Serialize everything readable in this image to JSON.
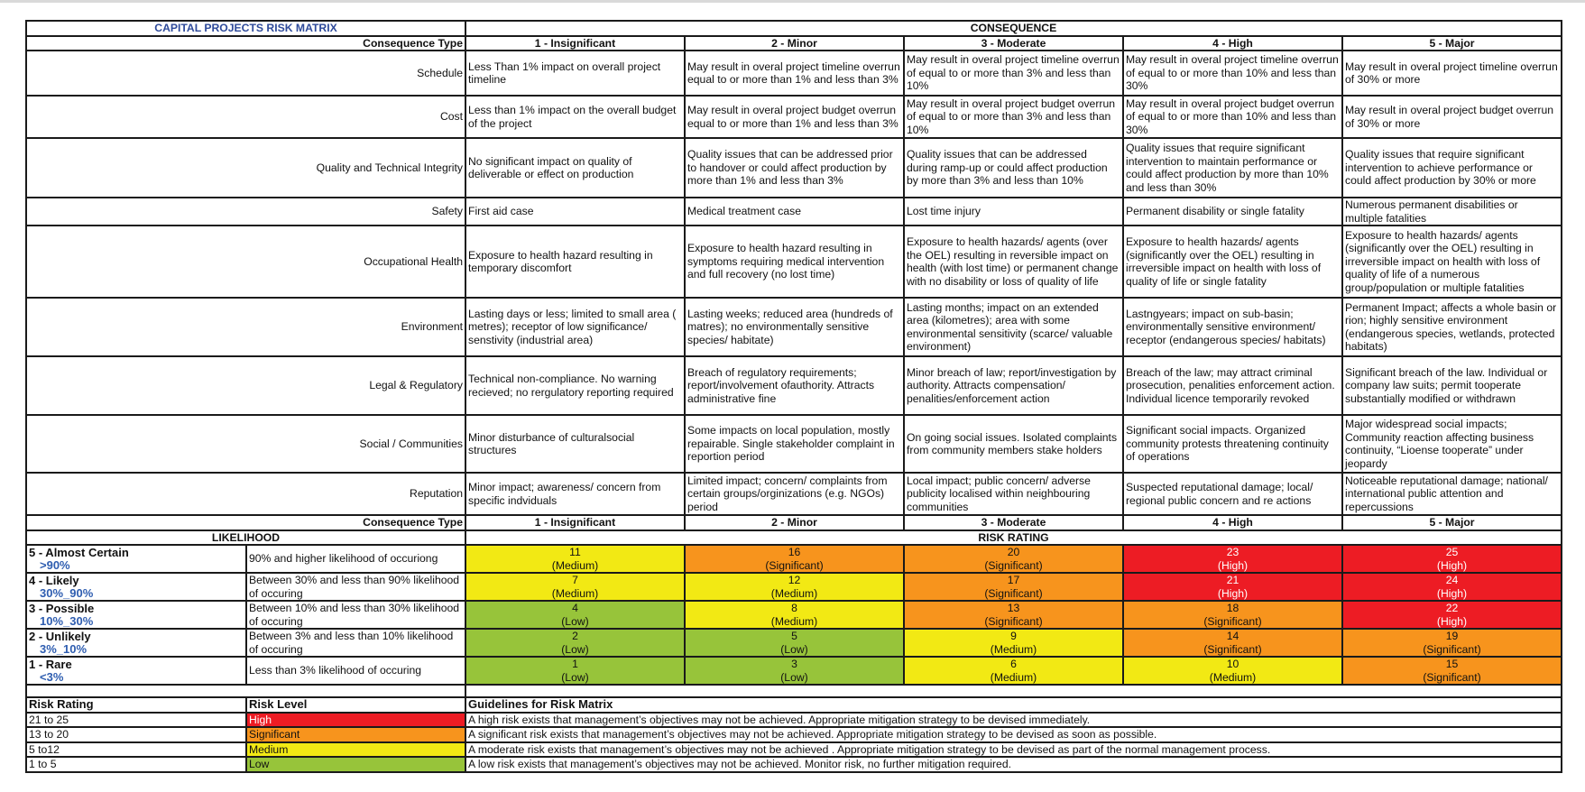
{
  "title": "CAPITAL PROJECTS RISK MATRIX",
  "consequence_header": "CONSEQUENCE",
  "consequence_type_label": "Consequence Type",
  "consequence_levels": [
    "1 - Insignificant",
    "2 - Minor",
    "3 - Moderate",
    "4 - High",
    "5 - Major"
  ],
  "consequence_rows": [
    {
      "type": "Schedule",
      "cells": [
        "Less Than 1% impact on overall project timeline",
        "May result in overal project timeline overrun equal to or more than 1% and less than 3%",
        "May result in overal project timeline overrun of equal to or more than 3% and less than 10%",
        "May result in overal project timeline overrun of equal to or more than 10% and less than 30%",
        "May result in overal project timeline overrun of 30% or more"
      ]
    },
    {
      "type": "Cost",
      "cells": [
        "Less than 1% impact on  the overall budget of the project",
        "May result in overal project budget overrun equal to or more than 1% and less than 3%",
        "May result in overal project budget overrun of equal to or more than 3% and less than 10%",
        "May result in overal project budget overrun of equal to or more than 10% and less than 30%",
        "May result in overal project budget overrun of 30% or more"
      ]
    },
    {
      "type": "Quality and Technical Integrity",
      "cells": [
        "No significant impact on quality of deliverable or effect on production",
        "Quality issues that can be addressed prior to handover or could affect production by more than 1% and less than 3%",
        "Quality issues that can be addressed during ramp-up or could affect production by more than 3% and less than 10%",
        "Quality issues that require significant intervention to maintain performance or could affect production by more than 10% and less than 30%",
        "Quality issues that require significant intervention to achieve performance or could affect production by 30% or more"
      ]
    },
    {
      "type": "Safety",
      "cells": [
        "First aid case",
        "Medical treatment case",
        "Lost time injury",
        "Permanent disability or single fatality",
        "Numerous permanent disabilities or multiple fatalities"
      ]
    },
    {
      "type": "Occupational Health",
      "cells": [
        "Exposure to health hazard resulting in temporary discomfort",
        "Exposure to health hazard resulting in symptoms requiring medical intervention and full recovery (no lost time)",
        "Exposure to health hazards/ agents (over the OEL) resulting in reversible impact on health (with lost time) or permanent change with no disability or loss of quality of life",
        "Exposure to health hazards/ agents (significantly over the OEL) resulting in irreversible impact on health with loss of quality of life or single fatality",
        "Exposure to health hazards/ agents (significantly over the OEL) resulting in irreversible impact on health with loss of quality of life of a numerous group/population or multiple fatalities"
      ]
    },
    {
      "type": "Environment",
      "cells": [
        "Lasting days or less; limited to small area ( metres); receptor of low significance/ senstivity (industrial area)",
        "Lasting weeks; reduced area (hundreds of matres); no environmentally sensitive species/ habitate)",
        "Lasting months; impact on an extended area (kilometres); area with some environmental sensitivity (scarce/ valuable environment)",
        "Lastngyears; impact on sub-basin; environmentally sensitive environment/ receptor (endangerous species/ habitats)",
        "Permanent Impact; affects a whole basin or rion; highly sensitive environment (endangerous species, wetlands, protected habitats)"
      ]
    },
    {
      "type": "Legal & Regulatory",
      "cells": [
        "Technical non-compliance. No warning recieved; no rergulatory reporting required",
        "Breach of regulatory requirements; report/involvement ofauthority. Attracts administrative fine",
        "Minor breach of law; report/investigation by authority. Attracts compensation/ penalities/enforcement action",
        "Breach of the law; may attract criminal prosecution, penalities enforcement action. Individual licence temporarily revoked",
        "Significant breach of the law. Individual or company law suits; permit tooperate substantially modified or withdrawn"
      ]
    },
    {
      "type": "Social / Communities",
      "cells": [
        "Minor disturbance of culturalsocial structures",
        "Some impacts on local population, mostly repairable. Single stakeholder complaint in reportion period",
        "On going social issues. Isolated complaints from community members stake holders",
        "Significant social impacts. Organized community protests threatening continuity of operations",
        "Major widespread social impacts; Community reaction affecting business continuity, “Lioense tooperate” under jeopardy"
      ]
    },
    {
      "type": "Reputation",
      "cells": [
        "Minor impact; awareness/ concern from specific indviduals",
        "Limited impact; concern/ complaints from certain groups/orginizations (e.g. NGOs) period",
        "Local impact; public concern/ adverse publicity localised within neighbouring communities",
        "Suspected reputational damage; local/ regional public concern and re actions",
        "Noticeable reputational damage; national/ international public attention and repercussions"
      ]
    }
  ],
  "likelihood_header": "LIKELIHOOD",
  "risk_rating_header": "RISK RATING",
  "likelihood_rows": [
    {
      "name": "5 - Almost Certain",
      "range": ">90%",
      "description": "90% and higher likelihood of occuriong",
      "ratings": [
        {
          "score": "11",
          "level": "(Medium)",
          "cls": "m"
        },
        {
          "score": "16",
          "level": "(Significant)",
          "cls": "s"
        },
        {
          "score": "20",
          "level": "(Significant)",
          "cls": "s"
        },
        {
          "score": "23",
          "level": "(High)",
          "cls": "h"
        },
        {
          "score": "25",
          "level": "(High)",
          "cls": "h"
        }
      ]
    },
    {
      "name": "4 - Likely",
      "range": "30%_90%",
      "description": "Between 30% and less than 90% likelihood of occuring",
      "ratings": [
        {
          "score": "7",
          "level": "(Medium)",
          "cls": "m"
        },
        {
          "score": "12",
          "level": "(Medium)",
          "cls": "m"
        },
        {
          "score": "17",
          "level": "(Significant)",
          "cls": "s"
        },
        {
          "score": "21",
          "level": "(High)",
          "cls": "h"
        },
        {
          "score": "24",
          "level": "(High)",
          "cls": "h"
        }
      ]
    },
    {
      "name": "3 - Possible",
      "range": "10%_30%",
      "description": "Between 10% and less than 30% likelihood of occuring",
      "ratings": [
        {
          "score": "4",
          "level": "(Low)",
          "cls": "l"
        },
        {
          "score": "8",
          "level": "(Medium)",
          "cls": "m"
        },
        {
          "score": "13",
          "level": "(Significant)",
          "cls": "s"
        },
        {
          "score": "18",
          "level": "(Significant)",
          "cls": "s"
        },
        {
          "score": "22",
          "level": "(High)",
          "cls": "h"
        }
      ]
    },
    {
      "name": "2 - Unlikely",
      "range": "3%_10%",
      "description": "Between 3% and less than 10% likelihood of occuring",
      "ratings": [
        {
          "score": "2",
          "level": "(Low)",
          "cls": "l"
        },
        {
          "score": "5",
          "level": "(Low)",
          "cls": "l"
        },
        {
          "score": "9",
          "level": "(Medium)",
          "cls": "m"
        },
        {
          "score": "14",
          "level": "(Significant)",
          "cls": "s"
        },
        {
          "score": "19",
          "level": "(Significant)",
          "cls": "s"
        }
      ]
    },
    {
      "name": "1 - Rare",
      "range": "<3%",
      "description": "Less than 3% likelihood of occuring",
      "ratings": [
        {
          "score": "1",
          "level": "(Low)",
          "cls": "l"
        },
        {
          "score": "3",
          "level": "(Low)",
          "cls": "l"
        },
        {
          "score": "6",
          "level": "(Medium)",
          "cls": "m"
        },
        {
          "score": "10",
          "level": "(Medium)",
          "cls": "m"
        },
        {
          "score": "15",
          "level": "(Significant)",
          "cls": "s"
        }
      ]
    }
  ],
  "legend": {
    "headers": {
      "rating": "Risk Rating",
      "level": "Risk Level",
      "guidelines": "Guidelines for Risk Matrix"
    },
    "rows": [
      {
        "rating": "21 to 25",
        "level": "High",
        "cls": "h",
        "guideline": "A high risk exists that management’s objectives may not be achieved. Appropriate mitigation strategy to be devised immediately."
      },
      {
        "rating": "13 to 20",
        "level": "Significant",
        "cls": "s",
        "guideline": "A significant risk exists that management’s objectives may not be achieved. Appropriate  mitigation strategy to be devised as soon as possible."
      },
      {
        "rating": "5 to12",
        "level": "Medium",
        "cls": "m",
        "guideline": "A moderate risk exists that management’s objectives may not be achieved . Appropriate mitigation strategy to be devised as part of the normal management process."
      },
      {
        "rating": "1 to 5",
        "level": "Low",
        "cls": "l",
        "guideline": "A low risk exists that management’s objectives may not be achieved. Monitor risk, no further mitigation required."
      }
    ]
  },
  "colors": {
    "high": "#ed1c24",
    "significant": "#f7941d",
    "medium": "#f2e914",
    "low": "#97c43a",
    "title_blue": "#2e4a9a",
    "range_blue": "#2e5db0"
  }
}
